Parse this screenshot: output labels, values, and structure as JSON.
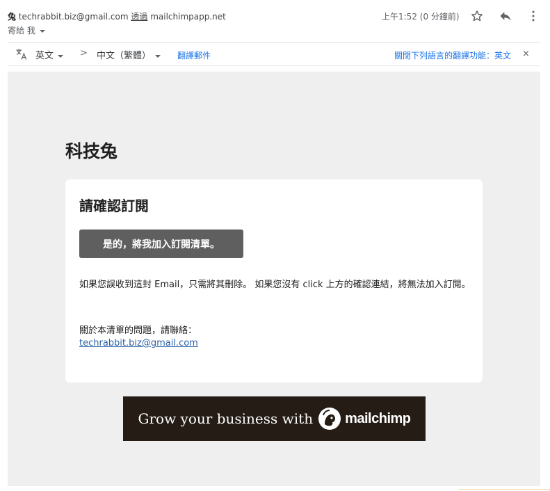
{
  "header": {
    "sender_name": "兔",
    "sender_email": "techrabbit.biz@gmail.com",
    "via_label": "透過",
    "via_domain": "mailchimpapp.net",
    "to_label": "寄給 我",
    "time": "上午1:52 (0 分鐘前)",
    "icons": [
      "star-icon",
      "reply-icon",
      "more-vert-icon"
    ]
  },
  "translate_bar": {
    "source_lang": "英文",
    "target_lang": "中文（繁體）",
    "arrow": ">",
    "translate_link": "翻譯郵件",
    "turn_off_link": "關閉下列語言的翻譯功能：英文",
    "close": "×"
  },
  "email": {
    "brand": "科技兔",
    "card_title": "請確認訂閱",
    "confirm_button": "是的，將我加入訂閱清單。",
    "notice": "如果您誤收到這封 Email，只需將其刪除。 如果您沒有 click 上方的確認連結，將無法加入訂閱。",
    "contact_label": "關於本清單的問題，請聯絡：",
    "contact_email": "techrabbit.biz@gmail.com",
    "banner_text": "Grow your business with",
    "banner_brand": "mailchimp"
  },
  "colors": {
    "link_blue": "#1a73e8",
    "button_gray": "#5f5f5f",
    "banner_bg": "#241c15",
    "body_bg": "#efefef"
  }
}
